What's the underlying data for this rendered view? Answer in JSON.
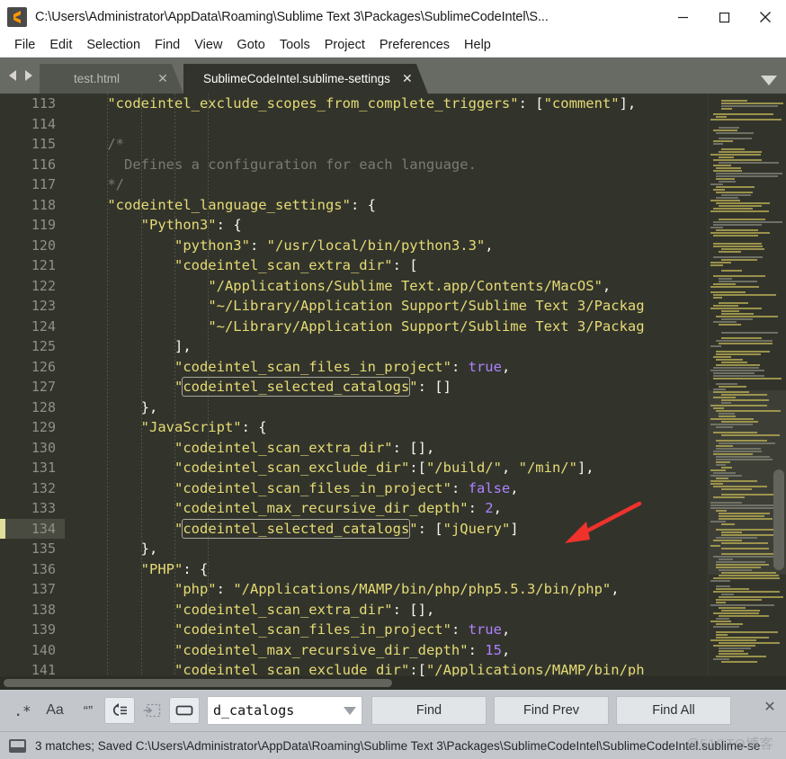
{
  "window": {
    "title": "C:\\Users\\Administrator\\AppData\\Roaming\\Sublime Text 3\\Packages\\SublimeCodeIntel\\S...",
    "logo_name": "sublime-text-logo",
    "minimize_label": "─",
    "maximize_label": "□",
    "close_label": "✕"
  },
  "menubar": {
    "items": [
      {
        "label": "File"
      },
      {
        "label": "Edit"
      },
      {
        "label": "Selection"
      },
      {
        "label": "Find"
      },
      {
        "label": "View"
      },
      {
        "label": "Goto"
      },
      {
        "label": "Tools"
      },
      {
        "label": "Project"
      },
      {
        "label": "Preferences"
      },
      {
        "label": "Help"
      }
    ]
  },
  "tabbar": {
    "prev_icon": "chevron-left-icon",
    "next_icon": "chevron-right-icon",
    "dropdown_icon": "chevron-down-icon",
    "close_glyph": "✕",
    "tabs": [
      {
        "label": "test.html",
        "active": false
      },
      {
        "label": "SublimeCodeIntel.sublime-settings",
        "active": true
      }
    ]
  },
  "editor": {
    "first_line_number": 113,
    "active_line": 134,
    "colors": {
      "background": "#32342c",
      "gutter_text": "#8e9185",
      "active_line_bg": "#494b40",
      "active_line_marker": "#dfdf9b",
      "string": "#e6db74",
      "punctuation": "#f8f8f2",
      "constant": "#ae81ff",
      "comment": "#797b70",
      "match_border": "#a8a89c"
    },
    "lines": [
      {
        "n": 113,
        "tokens": [
          {
            "t": "    ",
            "c": "p"
          },
          {
            "t": "\"codeintel_exclude_scopes_from_complete_triggers\"",
            "c": "s"
          },
          {
            "t": ": [",
            "c": "p"
          },
          {
            "t": "\"comment\"",
            "c": "s"
          },
          {
            "t": "],",
            "c": "p"
          }
        ]
      },
      {
        "n": 114,
        "tokens": []
      },
      {
        "n": 115,
        "tokens": [
          {
            "t": "    ",
            "c": "p"
          },
          {
            "t": "/*",
            "c": "c"
          }
        ]
      },
      {
        "n": 116,
        "tokens": [
          {
            "t": "      Defines a configuration for each language.",
            "c": "c"
          }
        ]
      },
      {
        "n": 117,
        "tokens": [
          {
            "t": "    */",
            "c": "c"
          }
        ]
      },
      {
        "n": 118,
        "tokens": [
          {
            "t": "    ",
            "c": "p"
          },
          {
            "t": "\"codeintel_language_settings\"",
            "c": "s"
          },
          {
            "t": ": {",
            "c": "p"
          }
        ]
      },
      {
        "n": 119,
        "tokens": [
          {
            "t": "        ",
            "c": "p"
          },
          {
            "t": "\"Python3\"",
            "c": "s"
          },
          {
            "t": ": {",
            "c": "p"
          }
        ]
      },
      {
        "n": 120,
        "tokens": [
          {
            "t": "            ",
            "c": "p"
          },
          {
            "t": "\"python3\"",
            "c": "s"
          },
          {
            "t": ": ",
            "c": "p"
          },
          {
            "t": "\"/usr/local/bin/python3.3\"",
            "c": "s"
          },
          {
            "t": ",",
            "c": "p"
          }
        ]
      },
      {
        "n": 121,
        "tokens": [
          {
            "t": "            ",
            "c": "p"
          },
          {
            "t": "\"codeintel_scan_extra_dir\"",
            "c": "s"
          },
          {
            "t": ": [",
            "c": "p"
          }
        ]
      },
      {
        "n": 122,
        "tokens": [
          {
            "t": "                ",
            "c": "p"
          },
          {
            "t": "\"/Applications/Sublime Text.app/Contents/MacOS\"",
            "c": "s"
          },
          {
            "t": ",",
            "c": "p"
          }
        ]
      },
      {
        "n": 123,
        "tokens": [
          {
            "t": "                ",
            "c": "p"
          },
          {
            "t": "\"~/Library/Application Support/Sublime Text 3/Packag",
            "c": "s"
          }
        ]
      },
      {
        "n": 124,
        "tokens": [
          {
            "t": "                ",
            "c": "p"
          },
          {
            "t": "\"~/Library/Application Support/Sublime Text 3/Packag",
            "c": "s"
          }
        ]
      },
      {
        "n": 125,
        "tokens": [
          {
            "t": "            ],",
            "c": "p"
          }
        ]
      },
      {
        "n": 126,
        "tokens": [
          {
            "t": "            ",
            "c": "p"
          },
          {
            "t": "\"codeintel_scan_files_in_project\"",
            "c": "s"
          },
          {
            "t": ": ",
            "c": "p"
          },
          {
            "t": "true",
            "c": "b"
          },
          {
            "t": ",",
            "c": "p"
          }
        ]
      },
      {
        "n": 127,
        "tokens": [
          {
            "t": "            ",
            "c": "p"
          },
          {
            "t": "\"",
            "c": "s"
          },
          {
            "t": "codeintel_selected_catalogs",
            "c": "s",
            "m": true
          },
          {
            "t": "\"",
            "c": "s"
          },
          {
            "t": ": []",
            "c": "p"
          }
        ]
      },
      {
        "n": 128,
        "tokens": [
          {
            "t": "        },",
            "c": "p"
          }
        ]
      },
      {
        "n": 129,
        "tokens": [
          {
            "t": "        ",
            "c": "p"
          },
          {
            "t": "\"JavaScript\"",
            "c": "s"
          },
          {
            "t": ": {",
            "c": "p"
          }
        ]
      },
      {
        "n": 130,
        "tokens": [
          {
            "t": "            ",
            "c": "p"
          },
          {
            "t": "\"codeintel_scan_extra_dir\"",
            "c": "s"
          },
          {
            "t": ": [],",
            "c": "p"
          }
        ]
      },
      {
        "n": 131,
        "tokens": [
          {
            "t": "            ",
            "c": "p"
          },
          {
            "t": "\"codeintel_scan_exclude_dir\"",
            "c": "s"
          },
          {
            "t": ":[",
            "c": "p"
          },
          {
            "t": "\"/build/\"",
            "c": "s"
          },
          {
            "t": ", ",
            "c": "p"
          },
          {
            "t": "\"/min/\"",
            "c": "s"
          },
          {
            "t": "],",
            "c": "p"
          }
        ]
      },
      {
        "n": 132,
        "tokens": [
          {
            "t": "            ",
            "c": "p"
          },
          {
            "t": "\"codeintel_scan_files_in_project\"",
            "c": "s"
          },
          {
            "t": ": ",
            "c": "p"
          },
          {
            "t": "false",
            "c": "b"
          },
          {
            "t": ",",
            "c": "p"
          }
        ]
      },
      {
        "n": 133,
        "tokens": [
          {
            "t": "            ",
            "c": "p"
          },
          {
            "t": "\"codeintel_max_recursive_dir_depth\"",
            "c": "s"
          },
          {
            "t": ": ",
            "c": "p"
          },
          {
            "t": "2",
            "c": "b"
          },
          {
            "t": ",",
            "c": "p"
          }
        ]
      },
      {
        "n": 134,
        "active": true,
        "tokens": [
          {
            "t": "            ",
            "c": "p"
          },
          {
            "t": "\"",
            "c": "s"
          },
          {
            "t": "codeintel_selected_catalogs",
            "c": "s",
            "m": true
          },
          {
            "t": "\"",
            "c": "s"
          },
          {
            "t": ": [",
            "c": "p"
          },
          {
            "t": "\"jQuery\"",
            "c": "s"
          },
          {
            "t": "]",
            "c": "p"
          }
        ]
      },
      {
        "n": 135,
        "tokens": [
          {
            "t": "        },",
            "c": "p"
          }
        ]
      },
      {
        "n": 136,
        "tokens": [
          {
            "t": "        ",
            "c": "p"
          },
          {
            "t": "\"PHP\"",
            "c": "s"
          },
          {
            "t": ": {",
            "c": "p"
          }
        ]
      },
      {
        "n": 137,
        "tokens": [
          {
            "t": "            ",
            "c": "p"
          },
          {
            "t": "\"php\"",
            "c": "s"
          },
          {
            "t": ": ",
            "c": "p"
          },
          {
            "t": "\"/Applications/MAMP/bin/php/php5.5.3/bin/php\"",
            "c": "s"
          },
          {
            "t": ",",
            "c": "p"
          }
        ]
      },
      {
        "n": 138,
        "tokens": [
          {
            "t": "            ",
            "c": "p"
          },
          {
            "t": "\"codeintel_scan_extra_dir\"",
            "c": "s"
          },
          {
            "t": ": [],",
            "c": "p"
          }
        ]
      },
      {
        "n": 139,
        "tokens": [
          {
            "t": "            ",
            "c": "p"
          },
          {
            "t": "\"codeintel_scan_files_in_project\"",
            "c": "s"
          },
          {
            "t": ": ",
            "c": "p"
          },
          {
            "t": "true",
            "c": "b"
          },
          {
            "t": ",",
            "c": "p"
          }
        ]
      },
      {
        "n": 140,
        "tokens": [
          {
            "t": "            ",
            "c": "p"
          },
          {
            "t": "\"codeintel_max_recursive_dir_depth\"",
            "c": "s"
          },
          {
            "t": ": ",
            "c": "p"
          },
          {
            "t": "15",
            "c": "b"
          },
          {
            "t": ",",
            "c": "p"
          }
        ]
      },
      {
        "n": 141,
        "tokens": [
          {
            "t": "            ",
            "c": "p"
          },
          {
            "t": "\"codeintel_scan_exclude_dir\"",
            "c": "s"
          },
          {
            "t": ":[",
            "c": "p"
          },
          {
            "t": "\"/Applications/MAMP/bin/ph",
            "c": "s"
          }
        ]
      }
    ]
  },
  "findbar": {
    "toggles": [
      {
        "name": "regex-toggle",
        "glyph": ".*",
        "on": false,
        "dim": false
      },
      {
        "name": "case-sensitive-toggle",
        "glyph": "Aa",
        "on": false,
        "dim": false
      },
      {
        "name": "whole-word-toggle",
        "glyph": "“ ”",
        "on": false,
        "dim": false
      },
      {
        "name": "wrap-toggle",
        "glyph": "↺≡",
        "on": true,
        "dim": false
      },
      {
        "name": "in-selection-toggle",
        "glyph": "⬚",
        "on": false,
        "dim": true
      },
      {
        "name": "highlight-results-toggle",
        "glyph": "▭",
        "on": true,
        "dim": false
      }
    ],
    "search_value": "d_catalogs",
    "search_placeholder": "Find",
    "dropdown_icon": "chevron-down-icon",
    "buttons": [
      {
        "label": "Find"
      },
      {
        "label": "Find Prev"
      },
      {
        "label": "Find All"
      }
    ],
    "close_glyph": "✕"
  },
  "statusbar": {
    "icon": "panel-icon",
    "text": "3 matches; Saved C:\\Users\\Administrator\\AppData\\Roaming\\Sublime Text 3\\Packages\\SublimeCodeIntel\\SublimeCodeIntel.sublime-se",
    "watermark": "@51CTO博客"
  }
}
